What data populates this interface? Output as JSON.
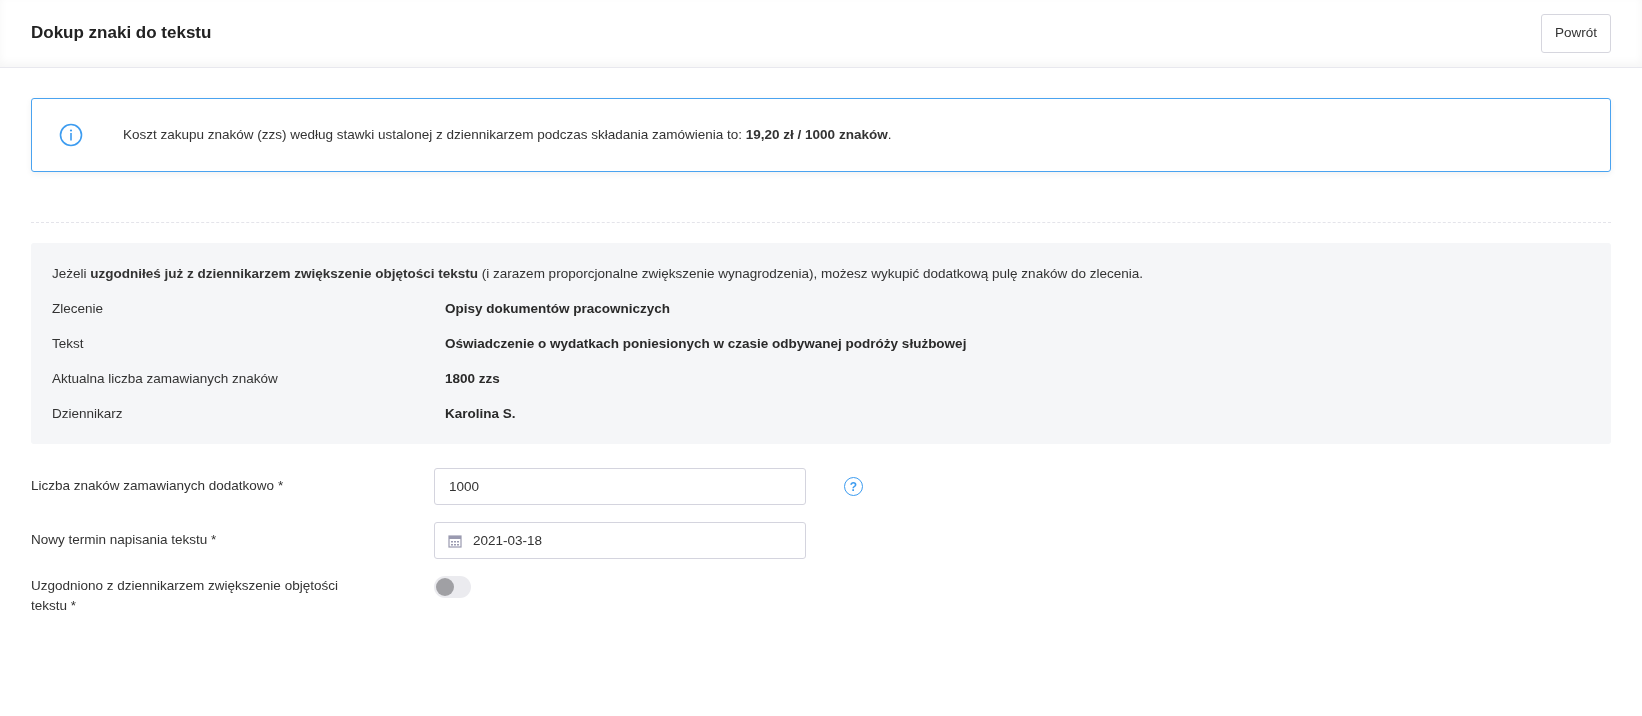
{
  "header": {
    "title": "Dokup znaki do tekstu",
    "back_button": "Powrót"
  },
  "info": {
    "text": "Koszt zakupu znaków (zzs) według stawki ustalonej z dziennikarzem podczas składania zamówienia to: **19,20 zł / 1000 znaków**."
  },
  "summary": {
    "intro": "Jeżeli **uzgodniłeś już z dziennikarzem zwiększenie objętości tekstu** (i zarazem proporcjonalne zwiększenie wynagrodzenia), możesz wykupić dodatkową pulę znaków do zlecenia.",
    "rows": [
      {
        "label": "Zlecenie",
        "value": "Opisy dokumentów pracowniczych"
      },
      {
        "label": "Tekst",
        "value": "Oświadczenie o wydatkach poniesionych w czasie odbywanej podróży służbowej"
      },
      {
        "label": "Aktualna liczba zamawianych znaków",
        "value": "1800 zzs"
      },
      {
        "label": "Dziennikarz",
        "value": "Karolina S."
      }
    ]
  },
  "form": [
    {
      "kind": "number",
      "label": "Liczba znaków zamawianych dodatkowo *",
      "value": "1000",
      "help": "?"
    },
    {
      "kind": "date",
      "label": "Nowy termin napisania tekstu *",
      "value": "2021-03-18"
    },
    {
      "kind": "switch",
      "label": "Uzgodniono z dziennikarzem zwiększenie objętości tekstu *",
      "on": false
    }
  ]
}
